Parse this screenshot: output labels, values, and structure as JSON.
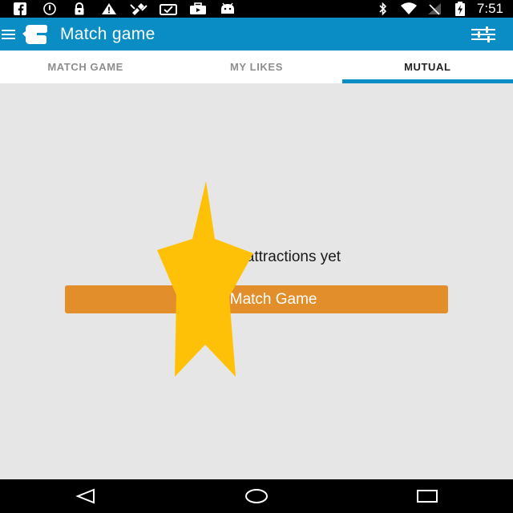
{
  "status_bar": {
    "time": "7:51",
    "left_icons": [
      "facebook-icon",
      "sync-icon",
      "lock-icon",
      "warning-icon",
      "satellite-icon",
      "clipboard-check-icon",
      "briefcase-play-icon",
      "android-icon"
    ],
    "right_icons": [
      "bluetooth-icon",
      "wifi-icon",
      "signal-icon",
      "battery-charging-icon"
    ]
  },
  "app_bar": {
    "title": "Match game",
    "color": "#0a8cc4"
  },
  "tabs": [
    {
      "label": "MATCH GAME",
      "active": false
    },
    {
      "label": "MY LIKES",
      "active": false
    },
    {
      "label": "MUTUAL",
      "active": true
    }
  ],
  "content": {
    "empty_message": "No mutual attractions yet",
    "play_button_label": "Play Match Game",
    "button_color": "#e28e2b",
    "overlay_color": "#ffc107"
  },
  "nav_bar": {
    "buttons": [
      "back-icon",
      "home-icon",
      "recents-icon"
    ]
  }
}
